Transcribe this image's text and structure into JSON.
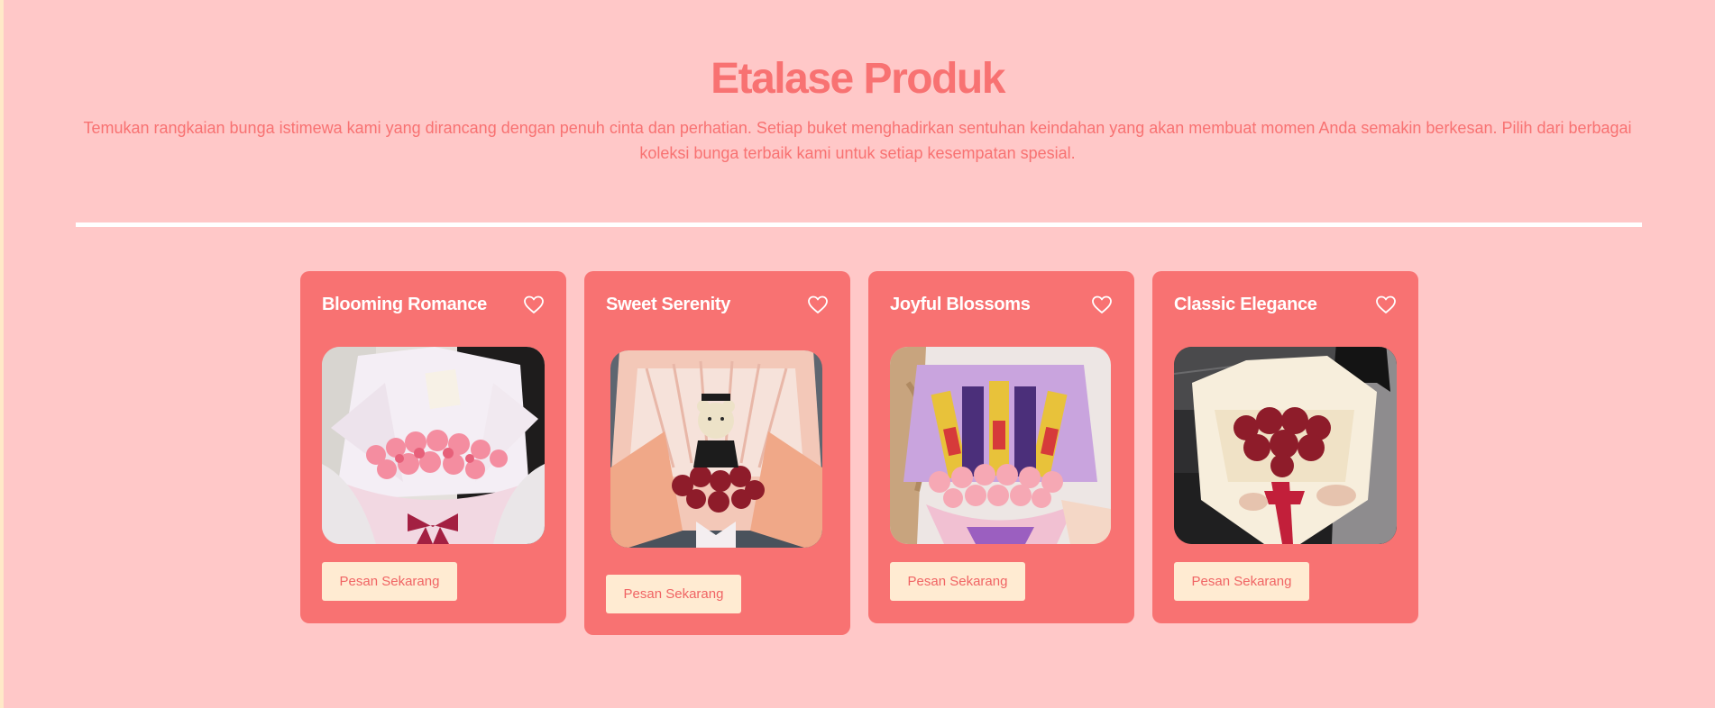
{
  "section": {
    "title": "Etalase Produk",
    "description": "Temukan rangkaian bunga istimewa kami yang dirancang dengan penuh cinta dan perhatian. Setiap buket menghadirkan sentuhan keindahan yang akan membuat momen Anda semakin berkesan. Pilih dari berbagai koleksi bunga terbaik kami untuk setiap kesempatan spesial."
  },
  "products": [
    {
      "name": "Blooming Romance",
      "button_label": "Pesan Sekarang",
      "icon": "heart-outline-icon"
    },
    {
      "name": "Sweet Serenity",
      "button_label": "Pesan Sekarang",
      "icon": "heart-outline-icon"
    },
    {
      "name": "Joyful Blossoms",
      "button_label": "Pesan Sekarang",
      "icon": "heart-outline-icon"
    },
    {
      "name": "Classic Elegance",
      "button_label": "Pesan Sekarang",
      "icon": "heart-outline-icon"
    }
  ],
  "colors": {
    "page_background": "#FFC8C8",
    "accent": "#F87272",
    "card_background": "#F87272",
    "button_background": "#FFEBD2",
    "button_text": "#F06464",
    "divider": "#FFFFFF"
  }
}
